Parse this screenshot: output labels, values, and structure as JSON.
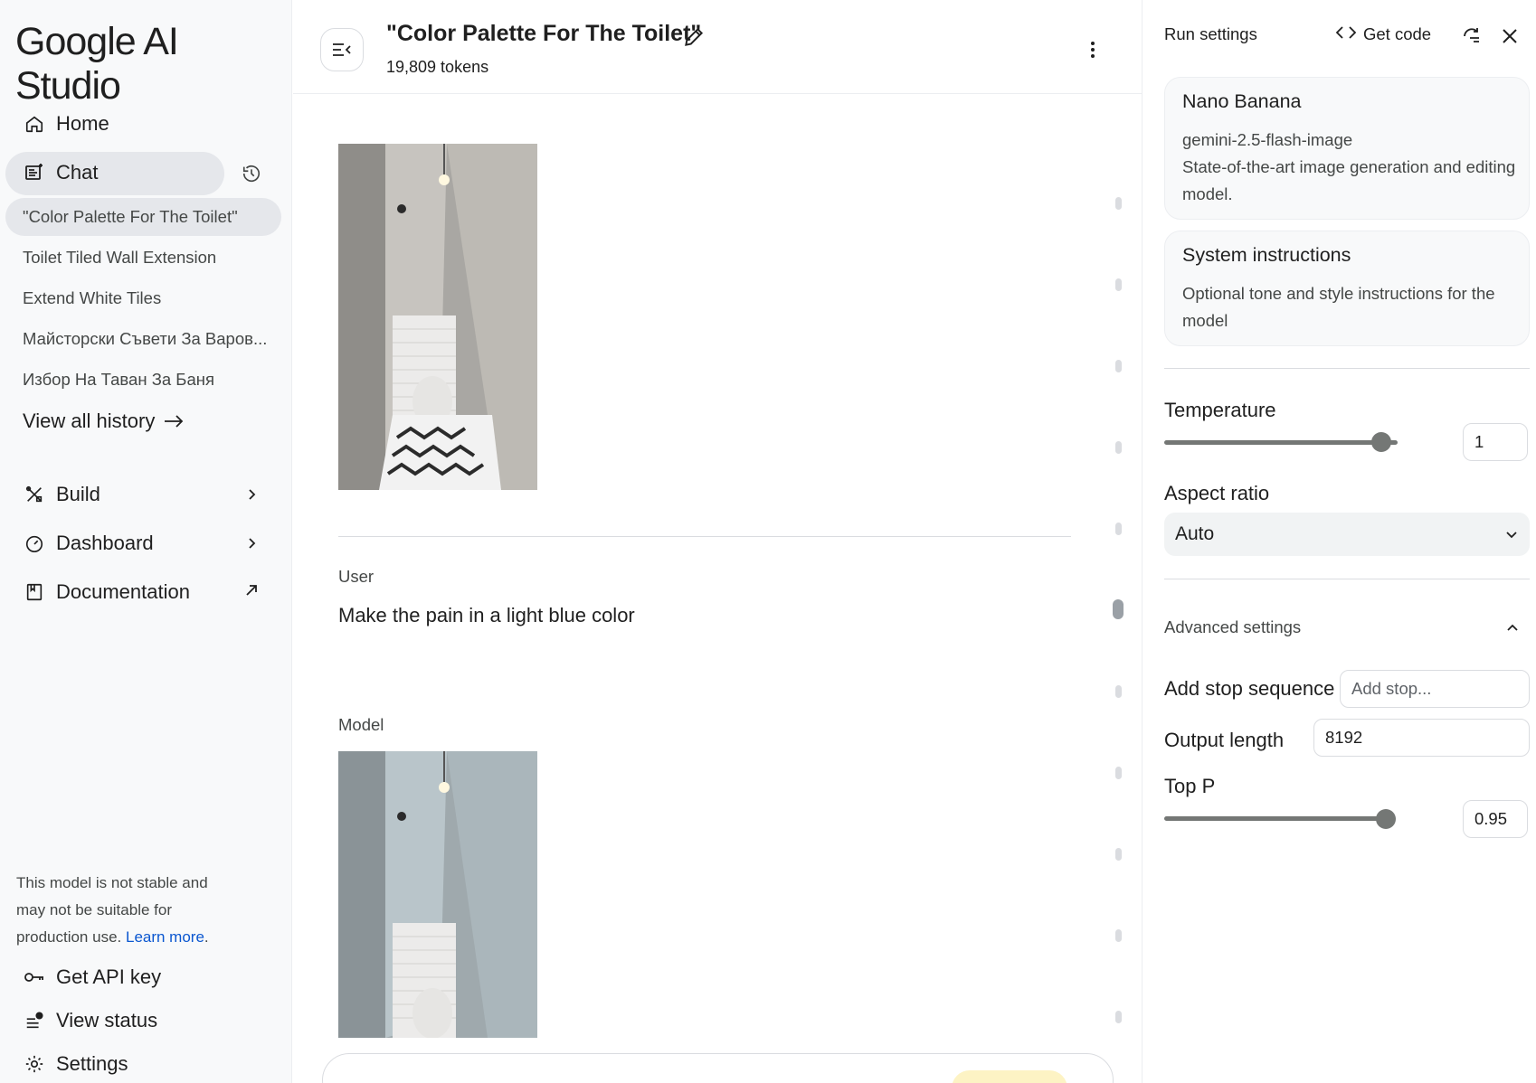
{
  "app": {
    "logo": "Google AI Studio"
  },
  "sidebar": {
    "home": "Home",
    "chat": "Chat",
    "history": [
      "\"Color Palette For The Toilet\"",
      "Toilet Tiled Wall Extension",
      "Extend White Tiles",
      "Майсторски Съвети За Варов...",
      "Избор На Таван За Баня"
    ],
    "view_all": "View all history",
    "build": "Build",
    "dashboard": "Dashboard",
    "documentation": "Documentation",
    "notice_text": "This model is not stable and may not be suitable for production use.",
    "notice_link": "Learn more",
    "notice_end": ".",
    "api_key": "Get API key",
    "view_status": "View status",
    "settings": "Settings"
  },
  "main": {
    "title": "\"Color Palette For The Toilet\"",
    "tokens": "19,809 tokens",
    "user_label": "User",
    "user_message": "Make the pain in a light blue color",
    "model_label": "Model"
  },
  "panel": {
    "title": "Run settings",
    "get_code": "Get code",
    "model_card": {
      "name": "Nano Banana",
      "id": "gemini-2.5-flash-image",
      "description": "State-of-the-art image generation and editing model."
    },
    "system_card": {
      "title": "System instructions",
      "description": "Optional tone and style instructions for the model"
    },
    "temperature": {
      "label": "Temperature",
      "value": "1",
      "fraction": 0.93
    },
    "aspect_ratio": {
      "label": "Aspect ratio",
      "value": "Auto"
    },
    "advanced": "Advanced settings",
    "stop_sequence": {
      "label": "Add stop sequence",
      "placeholder": "Add stop..."
    },
    "output_length": {
      "label": "Output length",
      "value": "8192"
    },
    "top_p": {
      "label": "Top P",
      "value": "0.95",
      "fraction": 0.95
    }
  },
  "colors": {
    "accent_link": "#0b57d0",
    "slider": "#747775",
    "run_button": "#fdf3c4"
  }
}
